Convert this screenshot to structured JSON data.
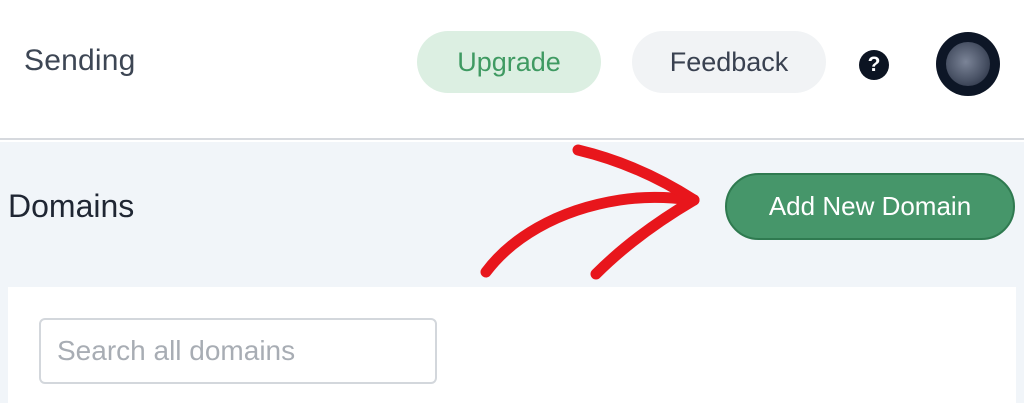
{
  "header": {
    "section_title": "Sending",
    "upgrade_label": "Upgrade",
    "feedback_label": "Feedback",
    "help_glyph": "?",
    "help_icon": "question-circle-icon",
    "avatar_icon": "user-avatar"
  },
  "domains": {
    "title": "Domains",
    "add_button_label": "Add New Domain",
    "search_placeholder": "Search all domains",
    "search_value": ""
  },
  "annotation": {
    "icon": "red-arrow-annotation",
    "color": "#e8161c"
  },
  "colors": {
    "accent_green": "#46966a",
    "upgrade_bg": "#dcefe2",
    "upgrade_text": "#3f9a62",
    "band_bg": "#f1f5f9"
  }
}
